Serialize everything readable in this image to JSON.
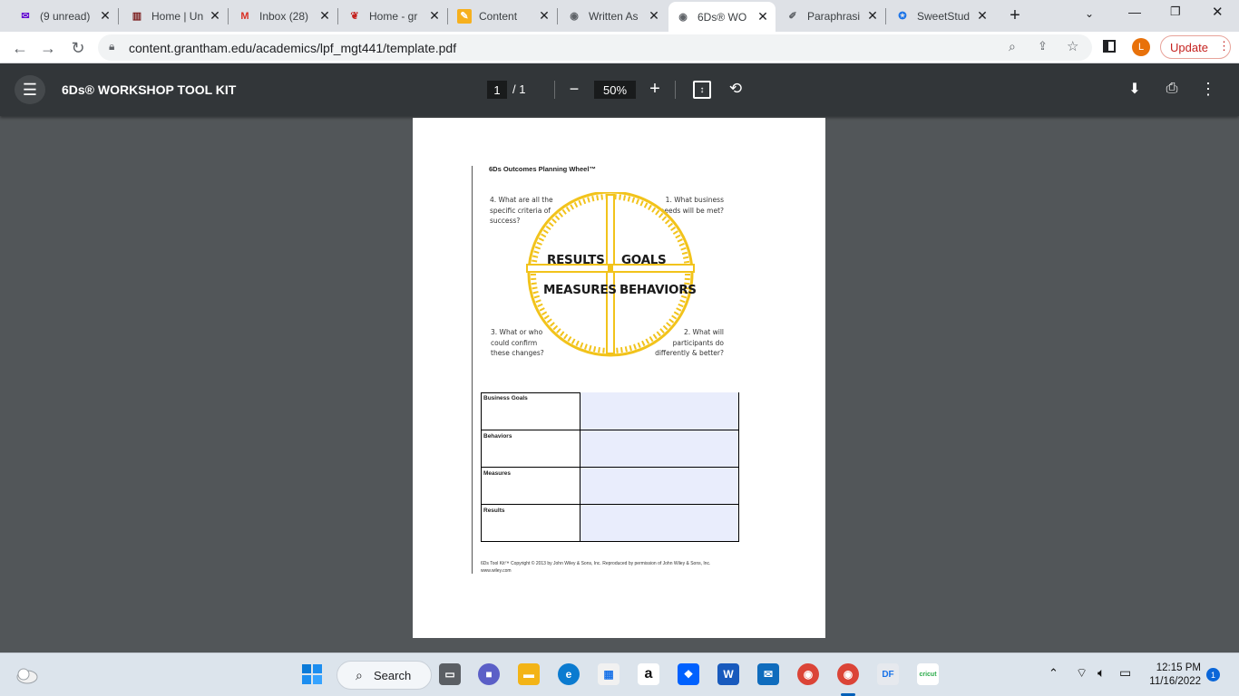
{
  "browser": {
    "tabs": [
      {
        "title": "(9 unread)",
        "icon": "yahoo-mail-icon",
        "active": false
      },
      {
        "title": "Home | Un",
        "icon": "university-icon",
        "active": false
      },
      {
        "title": "Inbox (28)",
        "icon": "gmail-icon",
        "active": false
      },
      {
        "title": "Home - gr",
        "icon": "grantham-icon",
        "active": false
      },
      {
        "title": "Content",
        "icon": "content-icon",
        "active": false
      },
      {
        "title": "Written As",
        "icon": "globe-icon",
        "active": false
      },
      {
        "title": "6Ds® WO",
        "icon": "globe-icon",
        "active": true
      },
      {
        "title": "Paraphrasi",
        "icon": "paraphrase-icon",
        "active": false
      },
      {
        "title": "SweetStud",
        "icon": "sweetstudy-icon",
        "active": false
      }
    ],
    "url": "content.grantham.edu/academics/lpf_mgt441/template.pdf",
    "profile_initial": "L",
    "update_label": "Update",
    "accent": "#e8710a"
  },
  "pdf": {
    "title": "6Ds® WORKSHOP TOOL KIT",
    "page_current": "1",
    "page_total": "/ 1",
    "zoom": "50%"
  },
  "document": {
    "wheel_title": "6Ds Outcomes Planning Wheel™",
    "q4": "4. What are all the specific criteria of success?",
    "q1": "1. What business needs will be met?",
    "q3": "3. What or who could confirm these changes?",
    "q2": "2. What will participants do differently & better?",
    "wheel": {
      "results": "RESULTS",
      "goals": "GOALS",
      "measures": "MEASURES",
      "behaviors": "BEHAVIORS",
      "color": "#f2c31b"
    },
    "table_rows": [
      "Business Goals",
      "Behaviors",
      "Measures",
      "Results"
    ],
    "footer": "6Ds Tool Kit™ Copyright © 2013 by John Wiley & Sons, Inc. Reproduced by permission of John Wiley & Sons, Inc. www.wiley.com"
  },
  "taskbar": {
    "search_label": "Search",
    "time": "12:15 PM",
    "date": "11/16/2022",
    "notification_count": "1"
  }
}
